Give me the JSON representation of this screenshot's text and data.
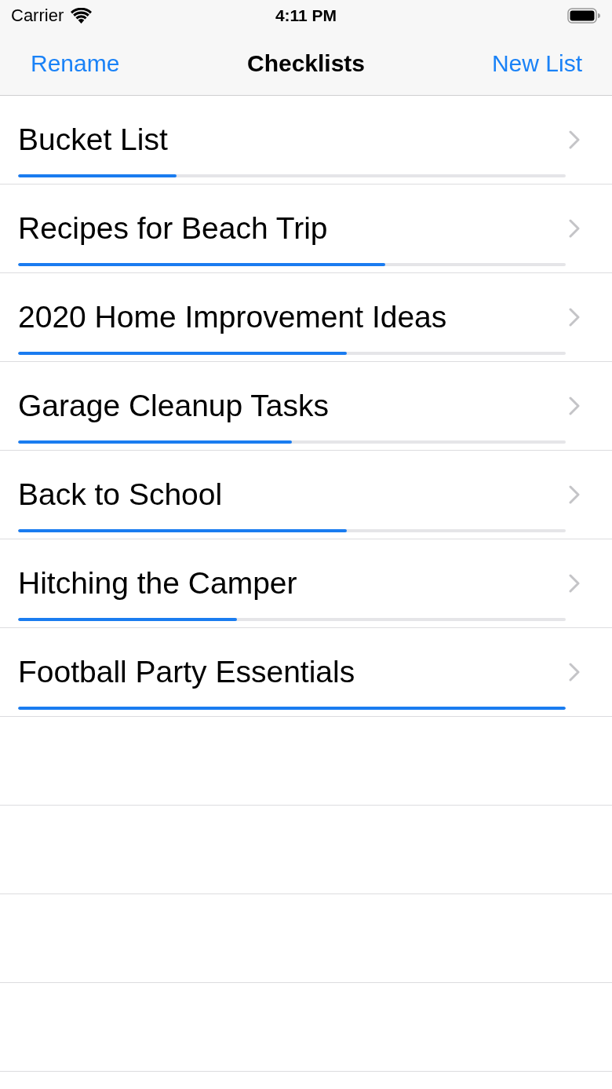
{
  "status_bar": {
    "carrier": "Carrier",
    "time": "4:11 PM"
  },
  "nav_bar": {
    "left_button": "Rename",
    "title": "Checklists",
    "right_button": "New List"
  },
  "checklists": [
    {
      "name": "Bucket List",
      "level": 0.29
    },
    {
      "name": "Recipes for Beach Trip",
      "level": 0.67
    },
    {
      "name": "2020 Home Improvement Ideas",
      "level": 0.6
    },
    {
      "name": "Garage Cleanup Tasks",
      "level": 0.5
    },
    {
      "name": "Back to School",
      "level": 0.6
    },
    {
      "name": "Hitching the Camper",
      "level": 0.4
    },
    {
      "name": "Football Party Essentials",
      "level": 1
    }
  ]
}
